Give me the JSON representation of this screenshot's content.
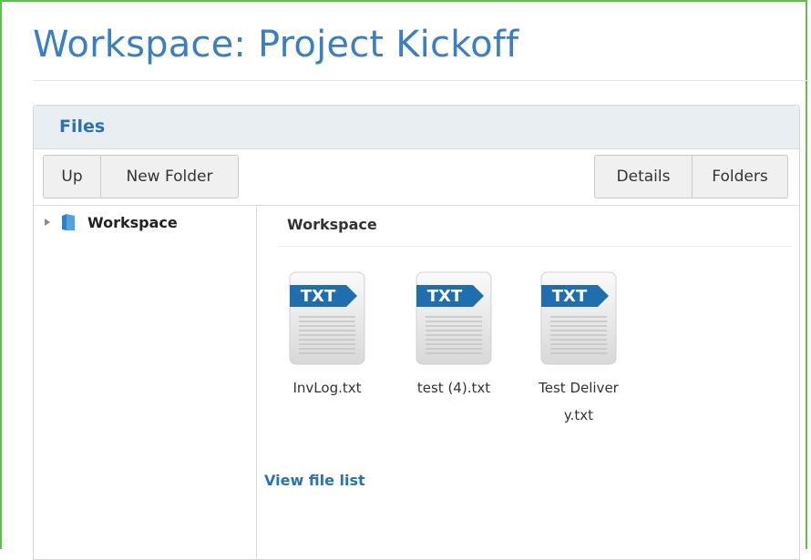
{
  "page": {
    "title": "Workspace: Project Kickoff"
  },
  "panel": {
    "title": "Files"
  },
  "toolbar": {
    "up_label": "Up",
    "new_folder_label": "New Folder",
    "details_label": "Details",
    "folders_label": "Folders"
  },
  "tree": {
    "root_label": "Workspace",
    "root_icon": "folder-icon",
    "expand_icon": "expand-arrow-icon"
  },
  "content": {
    "title": "Workspace",
    "files": [
      {
        "name": "InvLog.txt",
        "type_badge": "TXT",
        "icon": "txt-file-icon"
      },
      {
        "name": "test (4).txt",
        "type_badge": "TXT",
        "icon": "txt-file-icon"
      },
      {
        "name": "Test Delivery.txt",
        "type_badge": "TXT",
        "icon": "txt-file-icon"
      }
    ],
    "view_link": "View file list"
  },
  "colors": {
    "accent": "#3a7fc1",
    "link": "#2b72b0",
    "frame_border": "#5fbf4e",
    "panel_header_bg": "#e9eef2",
    "badge": "#1f6fb0"
  }
}
